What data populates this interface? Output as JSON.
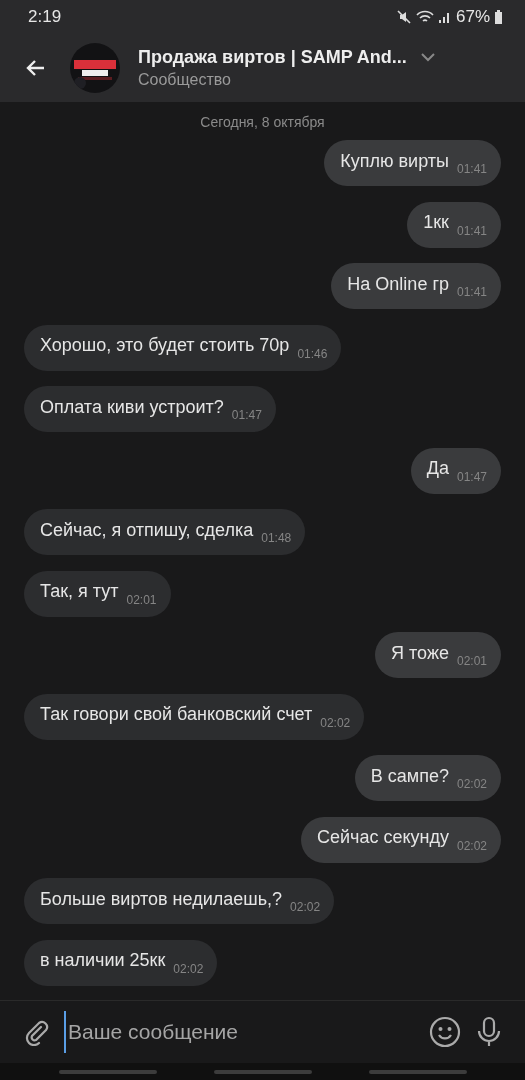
{
  "status_bar": {
    "time": "2:19",
    "battery": "67%"
  },
  "header": {
    "title": "Продажа виртов | SAMP And...",
    "subtitle": "Сообщество"
  },
  "date_separator": "Сегодня, 8 октября",
  "messages": [
    {
      "outgoing": true,
      "text": "Куплю вирты",
      "time": "01:41"
    },
    {
      "outgoing": true,
      "text": "1кк",
      "time": "01:41"
    },
    {
      "outgoing": true,
      "text": "На Online гр",
      "time": "01:41"
    },
    {
      "outgoing": false,
      "text": "Хорошо, это будет стоить 70р",
      "time": "01:46"
    },
    {
      "outgoing": false,
      "text": "Оплата киви устроит?",
      "time": "01:47"
    },
    {
      "outgoing": true,
      "text": "Да",
      "time": "01:47"
    },
    {
      "outgoing": false,
      "text": "Сейчас, я отпишу, сделка",
      "time": "01:48"
    },
    {
      "outgoing": false,
      "text": "Так, я тут",
      "time": "02:01"
    },
    {
      "outgoing": true,
      "text": "Я тоже",
      "time": "02:01"
    },
    {
      "outgoing": false,
      "text": "Так говори свой банковский счет",
      "time": "02:02"
    },
    {
      "outgoing": true,
      "text": "В сампе?",
      "time": "02:02"
    },
    {
      "outgoing": true,
      "text": "Сейчас секунду",
      "time": "02:02"
    },
    {
      "outgoing": false,
      "text": "Больше виртов недилаешь,?",
      "time": "02:02"
    },
    {
      "outgoing": false,
      "text": "в наличии 25кк",
      "time": "02:02"
    }
  ],
  "composer": {
    "placeholder": "Ваше сообщение"
  }
}
